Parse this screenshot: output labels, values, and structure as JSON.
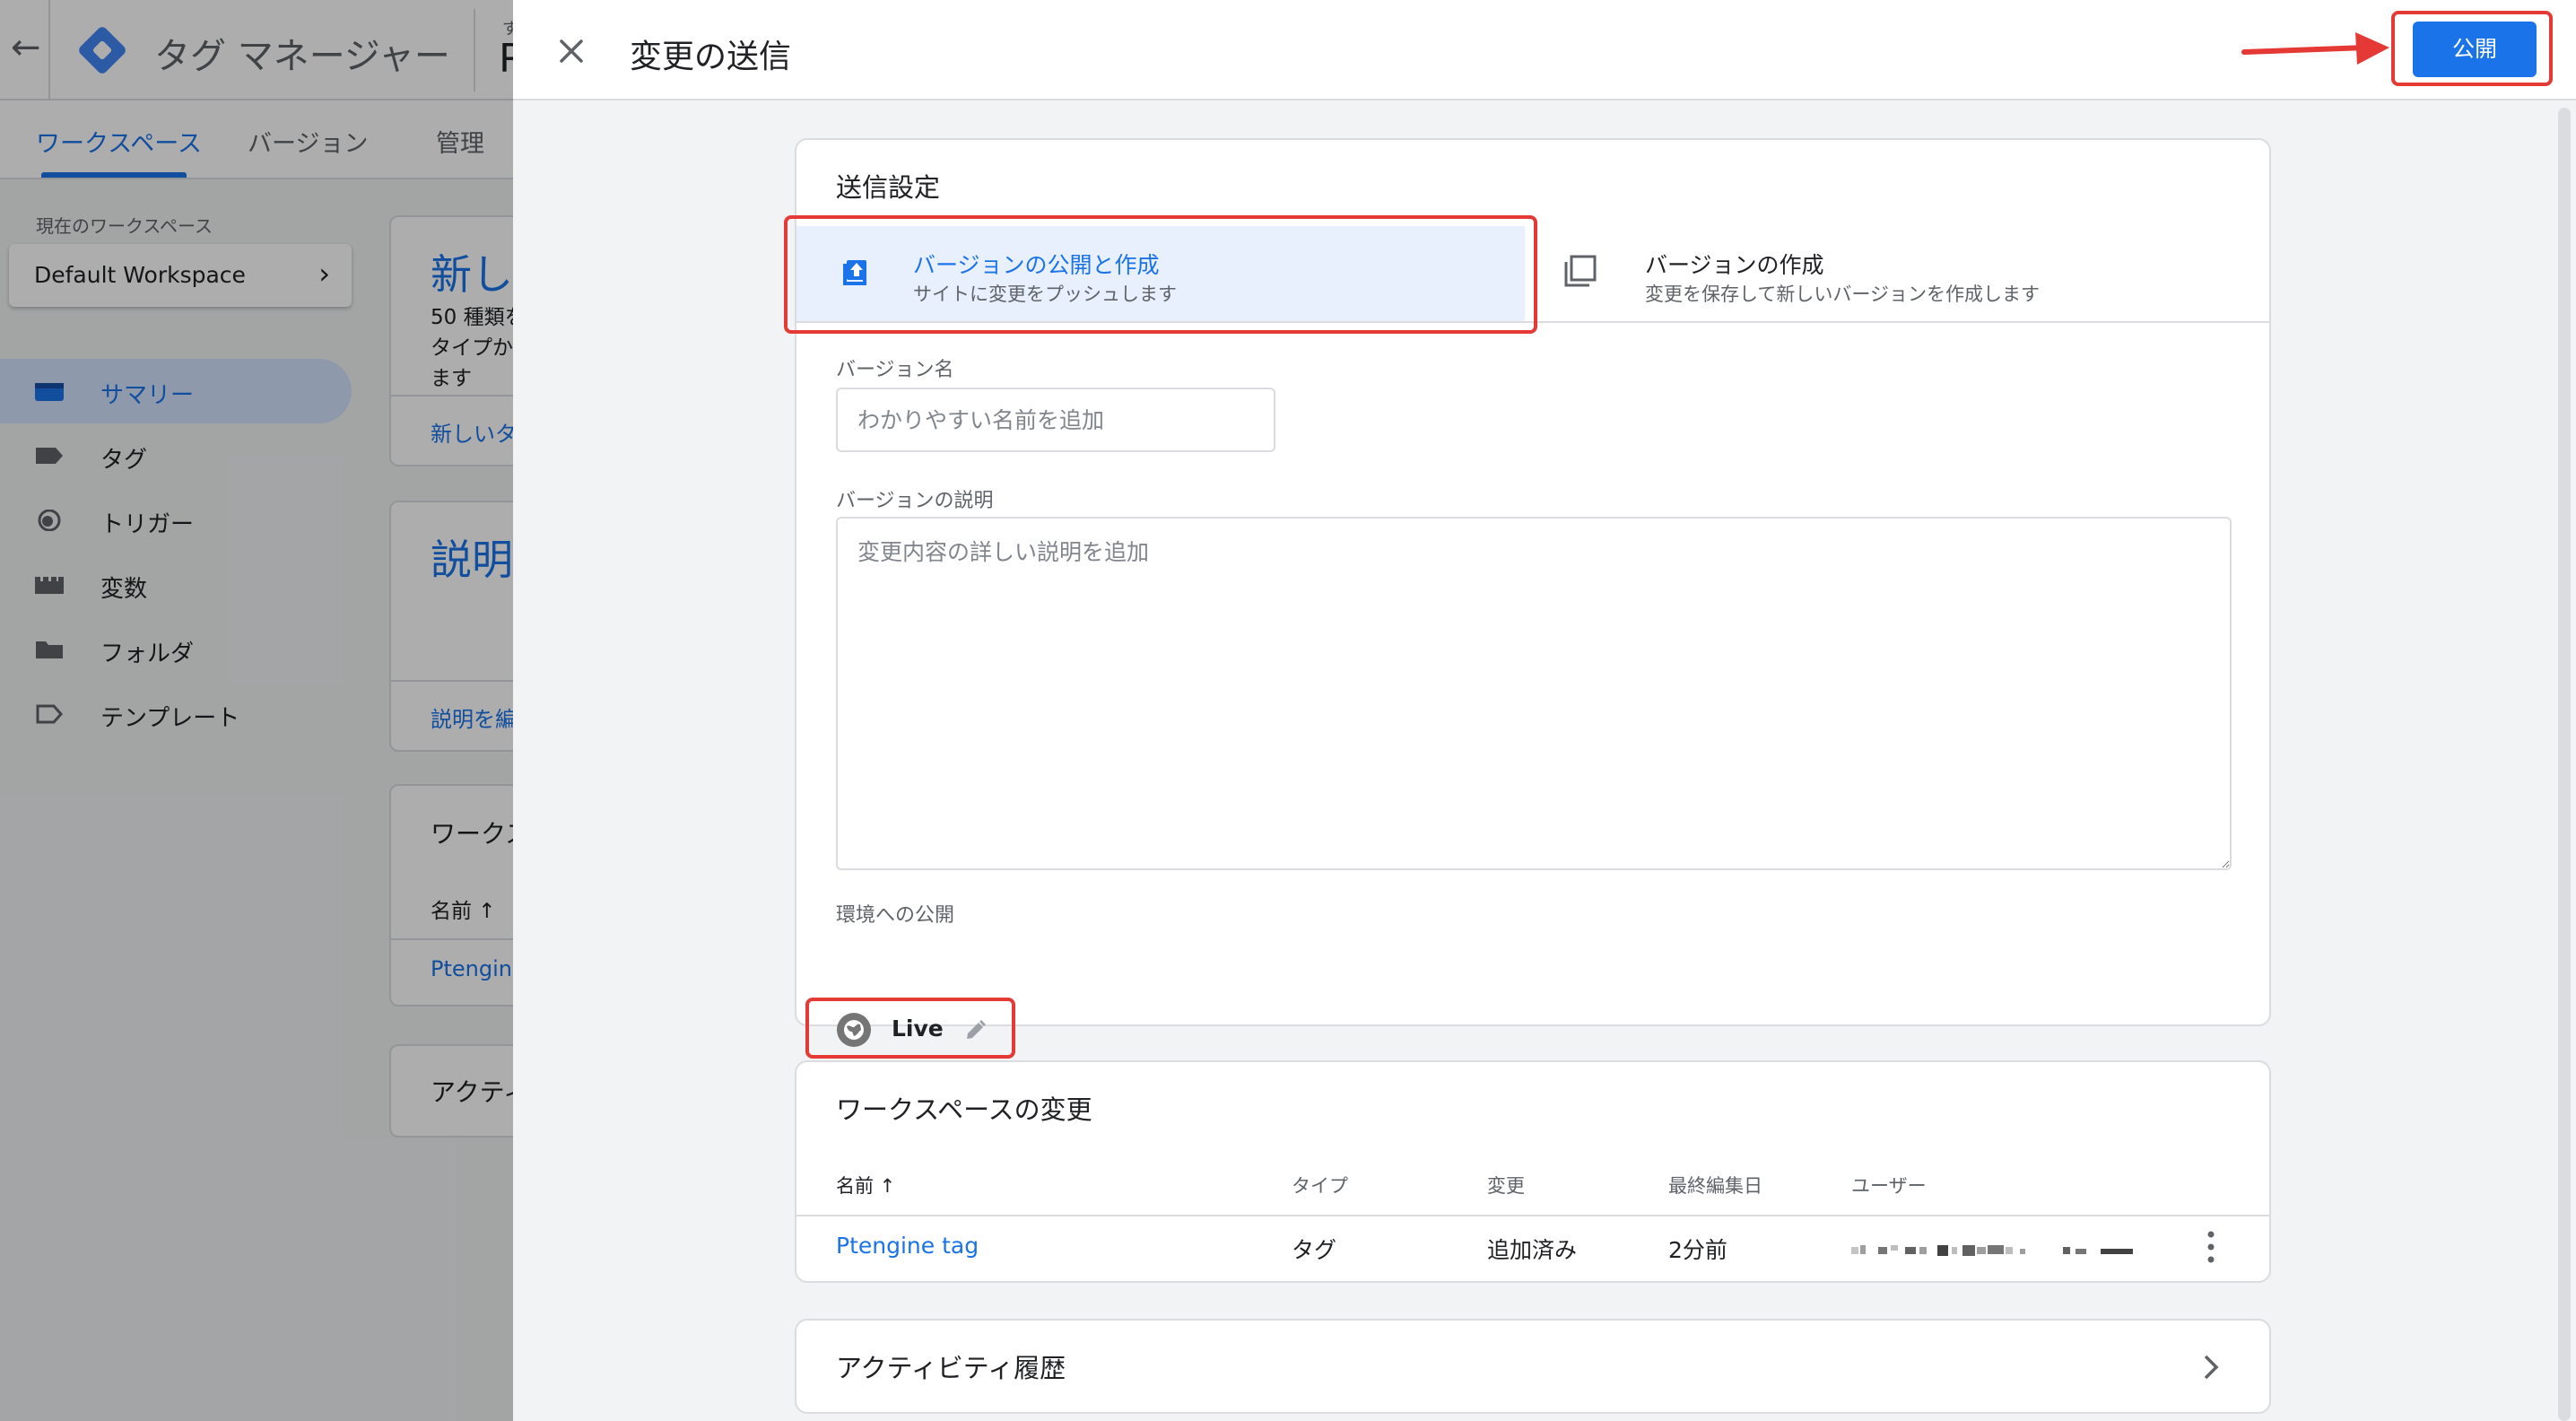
{
  "background": {
    "app_title": "タグ マネージャー",
    "account_small": "す",
    "account_big": "P",
    "nav_tabs": [
      {
        "label": "ワークスペース"
      },
      {
        "label": "バージョン"
      },
      {
        "label": "管理"
      }
    ],
    "current_workspace_label": "現在のワークスペース",
    "workspace_name": "Default Workspace",
    "sidebar": [
      {
        "label": "サマリー",
        "icon": "summary-icon"
      },
      {
        "label": "タグ",
        "icon": "tag-icon"
      },
      {
        "label": "トリガー",
        "icon": "trigger-icon"
      },
      {
        "label": "変数",
        "icon": "variables-icon"
      },
      {
        "label": "フォルダ",
        "icon": "folder-icon"
      },
      {
        "label": "テンプレート",
        "icon": "template-icon"
      }
    ],
    "cards": {
      "new_title": "新し",
      "new_line1": "50 種類を",
      "new_line2": "タイプか",
      "new_line3": "ます",
      "new_link": "新しいタ",
      "desc_title": "説明",
      "desc_link": "説明を編",
      "ws_changes_title": "ワークス",
      "ws_changes_col": "名前 ↑",
      "ws_changes_row": "Ptengine",
      "activity_title": "アクティ"
    }
  },
  "panel": {
    "title": "変更の送信",
    "publish_label": "公開",
    "submission": {
      "title": "送信設定",
      "options": [
        {
          "title": "バージョンの公開と作成",
          "subtitle": "サイトに変更をプッシュします",
          "icon": "publish-upload-icon",
          "selected": true
        },
        {
          "title": "バージョンの作成",
          "subtitle": "変更を保存して新しいバージョンを作成します",
          "icon": "copy-version-icon",
          "selected": false
        }
      ],
      "version_name_label": "バージョン名",
      "version_name_placeholder": "わかりやすい名前を追加",
      "version_name_value": "",
      "version_desc_label": "バージョンの説明",
      "version_desc_placeholder": "変更内容の詳しい説明を追加",
      "env_label": "環境への公開",
      "env_name": "Live"
    },
    "workspace_changes": {
      "title": "ワークスペースの変更",
      "columns": [
        "名前 ↑",
        "タイプ",
        "変更",
        "最終編集日",
        "ユーザー"
      ],
      "rows": [
        {
          "name": "Ptengine tag",
          "type": "タグ",
          "change": "追加済み",
          "last_edited": "2分前"
        }
      ]
    },
    "activity": {
      "title": "アクティビティ履歴"
    }
  },
  "colors": {
    "accent": "#1a73e8",
    "highlight_red": "#e53935",
    "selected_bg": "#e8f0fe"
  }
}
